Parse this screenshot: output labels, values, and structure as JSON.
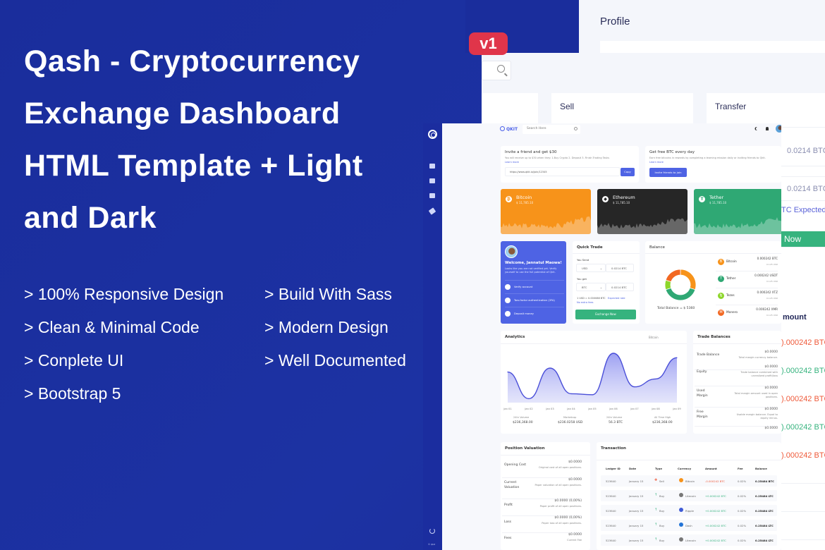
{
  "hero": {
    "title_lines": [
      "Qash - Cryptocurrency",
      "Exchange Dashboard",
      "HTML Template + Light",
      "and Dark"
    ],
    "version_badge": "v1",
    "features": [
      "> 100% Responsive Design",
      "> Build With Sass",
      "> Clean & Minimal Code",
      "> Modern Design",
      "> Conplete UI",
      "> Well Documented",
      "> Bootstrap 5"
    ]
  },
  "back_screen": {
    "page_title": "Profile",
    "cards": [
      "Sell",
      "Transfer"
    ]
  },
  "strip": {
    "send_value": "0.0214 BTC",
    "get_value": "0.0214 BTC",
    "expected": "TC Expected r",
    "button": "Now",
    "amount_header": "mount",
    "amounts": [
      {
        "text": ").000242 BTC",
        "color": "#ef5a3a"
      },
      {
        "text": ").000242 BTC",
        "color": "#36b37e"
      },
      {
        "text": ").000242 BTC",
        "color": "#ef5a3a"
      },
      {
        "text": ").000242 BTC",
        "color": "#36b37e"
      },
      {
        "text": ").000242 BTC",
        "color": "#ef5a3a"
      }
    ]
  },
  "dashboard": {
    "brand": "QKIT",
    "search_placeholder": "Search Here",
    "copyright": "© Qkit",
    "invite": {
      "title": "Invite a friend and get $30",
      "desc": "You will receive up to $30 when they:   1.Buy Crypto 2. Deposit 3. Finish Trading Tasks",
      "learn_more": "Learn more",
      "link": "https://www.qkit.io/join/12345",
      "copy_button": "Copy"
    },
    "free_btc": {
      "title": "Get free BTC every day",
      "desc": "Earn free bitcoins in rewards by completing a learning mission daily or inviting friends to Qkit.",
      "learn_more": "Learn more",
      "button": "Invite friends to join"
    },
    "coins": [
      {
        "name": "Bitcoin",
        "price": "$ 11,785.10",
        "symbol": "₿",
        "color": "#f7931a"
      },
      {
        "name": "Ethereum",
        "price": "$ 11,785.10",
        "symbol": "◆",
        "color": "#262626"
      },
      {
        "name": "Tether",
        "price": "$ 11,785.10",
        "symbol": "T",
        "color": "#2fa874"
      }
    ],
    "welcome": {
      "title": "Welcome, Jannatul Maowa!",
      "desc": "Looks like you are not verified yet. Verify yourself to use the full potential of Qkit.",
      "steps": [
        "Verify account",
        "Two-factor authentication (2FA)",
        "Deposit money"
      ]
    },
    "quick_trade": {
      "title": "Quick Trade",
      "send_label": "You Send",
      "send_currency": "USD",
      "send_value": "0.0214 BTC",
      "get_label": "You get",
      "get_currency": "BTC",
      "get_value": "0.0214 BTC",
      "rate": "1 USD = 0.000088 BTC",
      "expected": "Expected rate",
      "no_fees": "No extra fees",
      "button": "Exchange Now"
    },
    "balance": {
      "title": "Balance",
      "total": "Total Balance = $ 5360",
      "items": [
        {
          "name": "Bitcoin",
          "value": "0.000242 BTC",
          "usd": "0.125 USD",
          "color": "#f7931a",
          "symbol": "B"
        },
        {
          "name": "Tether",
          "value": "0.000242 USDT",
          "usd": "0.125 USD",
          "color": "#2fa874",
          "symbol": "T"
        },
        {
          "name": "Tezos",
          "value": "0.000242 XTZ",
          "usd": "0.125 USD",
          "color": "#8dd62a",
          "symbol": "ꜩ"
        },
        {
          "name": "Monero",
          "value": "0.000242 XMR",
          "usd": "0.125 USD",
          "color": "#f26822",
          "symbol": "M"
        }
      ],
      "donut": [
        {
          "label": "Bitcoin",
          "value": 30,
          "color": "#f7931a"
        },
        {
          "label": "Tether",
          "value": 40,
          "color": "#2fa874"
        },
        {
          "label": "Tezos",
          "value": 10,
          "color": "#8dd62a"
        },
        {
          "label": "Monero",
          "value": 20,
          "color": "#f26822"
        }
      ]
    },
    "analytics": {
      "title": "Analytics",
      "filter": "Bitcoin",
      "stats": [
        {
          "label": "24hr Volume",
          "value": "$236,368.00"
        },
        {
          "label": "Marketcap",
          "value": "$236.0258 USD"
        },
        {
          "label": "24hr Volume",
          "value": "56.3 BTC"
        },
        {
          "label": "All Time High",
          "value": "$236,368.00"
        }
      ]
    },
    "trade_balances": {
      "title": "Trade Balances",
      "rows": [
        {
          "label": "Trade Balance",
          "value": "$0.0000",
          "desc": "Total margin currency balance."
        },
        {
          "label": "Equity",
          "value": "$0.0000",
          "desc": "Trade balance combined with unrealized profit/loss"
        },
        {
          "label": "Used Margin",
          "value": "$0.0000",
          "desc": "Total margin amount used in open positions."
        },
        {
          "label": "Free Margin",
          "value": "$0.0000",
          "desc": "Usable margin balance. Equal to equity minus."
        },
        {
          "label": "",
          "value": "$0.0000",
          "desc": ""
        }
      ]
    },
    "position": {
      "title": "Position Valuation",
      "rows": [
        {
          "label": "Opening Cost",
          "value": "$0.0000",
          "desc": "Original cost of all open positions."
        },
        {
          "label": "Current Valuation",
          "value": "$0.0000",
          "desc": "Paper valuation of all open positions."
        },
        {
          "label": "Profit",
          "value": "$0.0000 (0,00%)",
          "desc": "Paper profit of all open positions."
        },
        {
          "label": "Loss",
          "value": "$0.0000 (0,00%)",
          "desc": "Paper loss of all open positions."
        },
        {
          "label": "Fees",
          "value": "$0.0000",
          "desc": "Current Fee"
        }
      ]
    },
    "transaction": {
      "title": "Transaction",
      "columns": [
        "Ledger ID",
        "Date",
        "Type",
        "Currency",
        "Amount",
        "Fee",
        "Balance"
      ],
      "rows": [
        {
          "id": "523640",
          "date": "January 15",
          "type": "Sell",
          "currency": "Bitcoin",
          "amount": "-0.000242 BTC",
          "fee": "0.02%",
          "balance": "0.25484 BTC",
          "coin_color": "#f7931a"
        },
        {
          "id": "523640",
          "date": "January 15",
          "type": "Buy",
          "currency": "Litecoin",
          "amount": "+0.000242 BTC",
          "fee": "0.02%",
          "balance": "0.25484 LTC",
          "coin_color": "#777"
        },
        {
          "id": "523640",
          "date": "January 15",
          "type": "Buy",
          "currency": "Ripple",
          "amount": "+0.000242 BTC",
          "fee": "0.02%",
          "balance": "0.25484 LTC",
          "coin_color": "#3f5bd6"
        },
        {
          "id": "523640",
          "date": "January 15",
          "type": "Buy",
          "currency": "Dash",
          "amount": "+0.000242 BTC",
          "fee": "0.02%",
          "balance": "0.25484 LTC",
          "coin_color": "#2273d6"
        },
        {
          "id": "523640",
          "date": "January 15",
          "type": "Buy",
          "currency": "Litecoin",
          "amount": "+0.000242 BTC",
          "fee": "0.02%",
          "balance": "0.25484 LTC",
          "coin_color": "#777"
        }
      ]
    }
  },
  "chart_data": {
    "type": "area",
    "title": "Analytics",
    "series_name": "Bitcoin",
    "x": [
      "Jan 01",
      "Jan 02",
      "Jan 03",
      "Jan 04",
      "Jan 05",
      "Jan 06",
      "Jan 07",
      "Jan 08",
      "Jan 09"
    ],
    "values": [
      62,
      8,
      70,
      18,
      16,
      100,
      32,
      48,
      91
    ],
    "ylim": [
      0,
      110
    ],
    "line_color": "#4a4fd8",
    "grid": false,
    "legend": "none"
  }
}
